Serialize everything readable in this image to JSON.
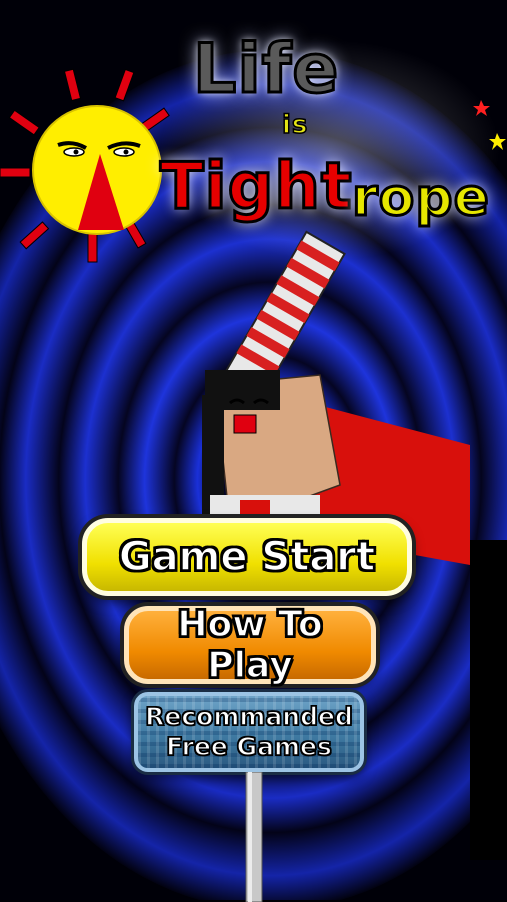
{
  "game": {
    "title": {
      "line1": "Life",
      "line2": "is",
      "line3a": "Tight",
      "line3b": "rope"
    },
    "menu": {
      "start_label": "Game Start",
      "how_to_play_label": "How To Play",
      "free_games_line1": "Recommanded",
      "free_games_line2": "Free Games"
    }
  },
  "colors": {
    "sky_dark": "#000010",
    "spiral_blue": "#1a2fd4",
    "sun_yellow": "#ffee00",
    "sun_ray_red": "#e00010",
    "button_start": "#f0e000",
    "button_howto": "#f08a00",
    "button_free_games": "#3f7aa2"
  },
  "icons": [
    "sun-icon",
    "star-icon",
    "tightrope-walker-character",
    "balance-pole"
  ]
}
